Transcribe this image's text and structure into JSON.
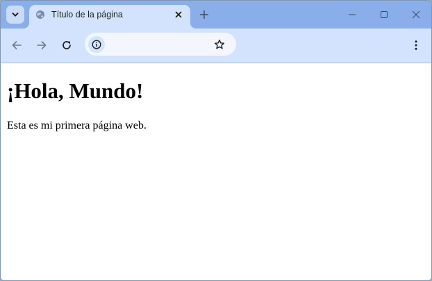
{
  "colors": {
    "tabstrip_bg": "#8aaee9",
    "active_tab_bg": "#d3e3fd",
    "toolbar_bg": "#d3e3fd",
    "omnibox_bg": "#f3f7fd",
    "icon_color": "#1f1f1f",
    "disabled_icon_color": "#6d7a8a",
    "page_bg": "#ffffff",
    "page_text": "#000000"
  },
  "tab_strip": {
    "tab_search_icon": "chevron-down-icon",
    "active_tab": {
      "title": "Título de la página",
      "favicon": "globe-icon",
      "close_icon": "close-icon"
    },
    "new_tab_icon": "plus-icon"
  },
  "window_controls": {
    "minimize_icon": "minimize-icon",
    "maximize_icon": "maximize-icon",
    "close_icon": "close-icon"
  },
  "toolbar": {
    "back_icon": "arrow-left-icon",
    "forward_icon": "arrow-right-icon",
    "reload_icon": "reload-icon",
    "site_info_icon": "info-icon",
    "address_value": "",
    "bookmark_icon": "star-icon",
    "menu_icon": "kebab-menu-icon"
  },
  "page": {
    "heading": "¡Hola, Mundo!",
    "paragraph": "Esta es mi primera página web."
  }
}
